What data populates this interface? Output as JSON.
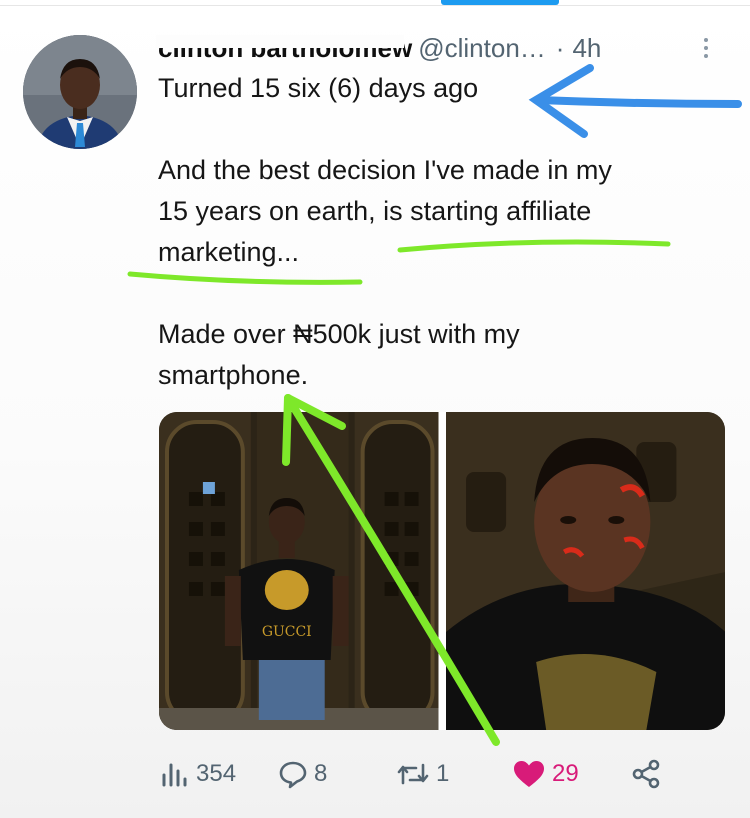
{
  "tweet": {
    "author_name": "clinton bartholomew",
    "handle": "@clinton…",
    "separator": "·",
    "time": "4h",
    "lines": [
      "Turned 15 six (6) days ago",
      "And the best decision I've made in my",
      "15 years on earth, is starting affiliate",
      "marketing...",
      "Made over ₦500k just with my",
      "smartphone."
    ],
    "media": [
      {
        "alt": "Boy in black Gucci t-shirt standing in front of metal gate"
      },
      {
        "alt": "Close-up selfie of boy in black Gucci t-shirt"
      }
    ],
    "shirt_text": "GUCCI"
  },
  "actions": {
    "views": "354",
    "replies": "8",
    "reposts": "1",
    "likes": "29"
  },
  "icons": {
    "views": "analytics-icon",
    "replies": "reply-icon",
    "reposts": "repost-icon",
    "likes": "heart-icon",
    "share": "share-icon",
    "more": "more-vertical-icon"
  },
  "colors": {
    "accent": "#1d9bf0",
    "like": "#d81b79",
    "annotation_blue": "#3a8fe8",
    "annotation_green": "#7ee82a"
  }
}
